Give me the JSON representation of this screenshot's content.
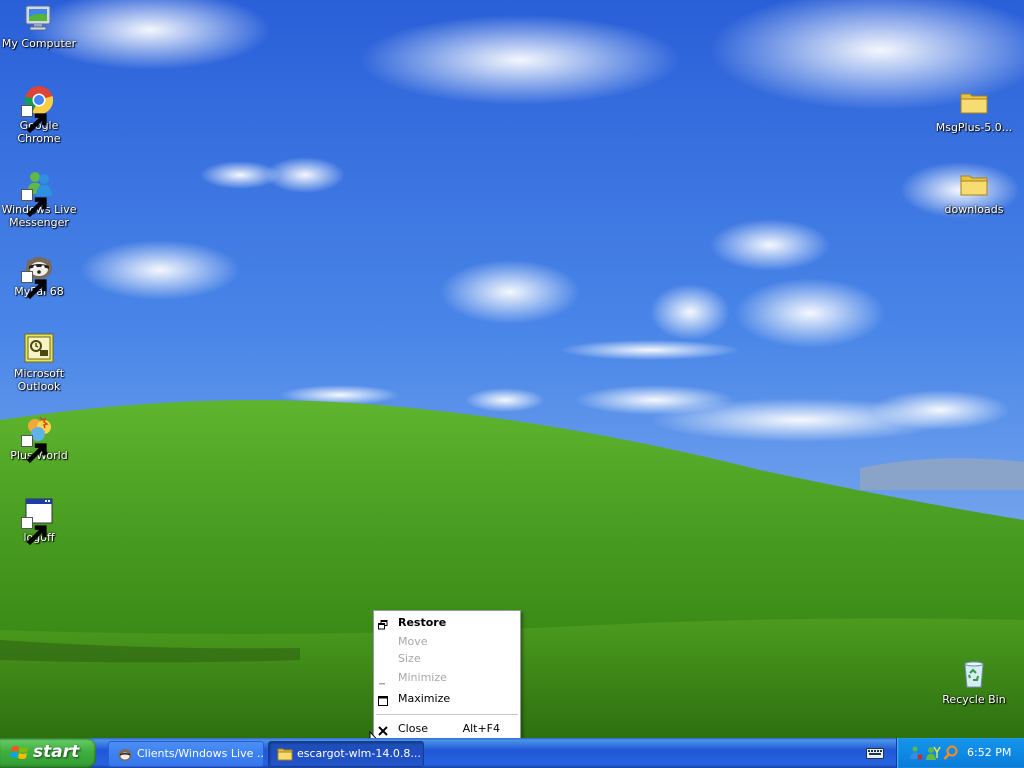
{
  "desktop": {
    "icons_left": [
      {
        "label": "My Computer",
        "icon": "my-computer-icon"
      },
      {
        "label": "Google Chrome",
        "icon": "chrome-icon"
      },
      {
        "label": "Windows Live Messenger",
        "icon": "messenger-icon"
      },
      {
        "label": "MyPal 68",
        "icon": "mypal-icon"
      },
      {
        "label": "Microsoft Outlook",
        "icon": "outlook-icon"
      },
      {
        "label": "Plus World",
        "icon": "plus-world-icon"
      },
      {
        "label": "logoff",
        "icon": "logoff-icon"
      }
    ],
    "icons_right": [
      {
        "label": "MsgPlus-5.0...",
        "icon": "folder-icon"
      },
      {
        "label": "downloads",
        "icon": "folder-icon"
      },
      {
        "label": "Recycle Bin",
        "icon": "recycle-bin-icon"
      }
    ]
  },
  "context_menu": {
    "items": [
      {
        "label": "Restore",
        "icon": "restore-icon",
        "enabled": true,
        "bold": true
      },
      {
        "label": "Move",
        "enabled": false
      },
      {
        "label": "Size",
        "enabled": false
      },
      {
        "label": "Minimize",
        "icon": "minimize-icon",
        "enabled": false
      },
      {
        "label": "Maximize",
        "icon": "maximize-icon",
        "enabled": true
      },
      {
        "label": "Close",
        "icon": "close-icon",
        "accelerator": "Alt+F4",
        "enabled": true
      }
    ]
  },
  "taskbar": {
    "start_label": "start",
    "tasks": [
      {
        "label": "Clients/Windows Live ...",
        "icon": "messenger-icon",
        "active": false
      },
      {
        "label": "escargot-wlm-14.0.8...",
        "icon": "folder-icon",
        "active": true
      }
    ],
    "clock": "6:52 PM"
  },
  "colors": {
    "taskbar_blue": "#2457d6",
    "start_green": "#3fae3f",
    "tray_blue": "#0e8ae5"
  }
}
